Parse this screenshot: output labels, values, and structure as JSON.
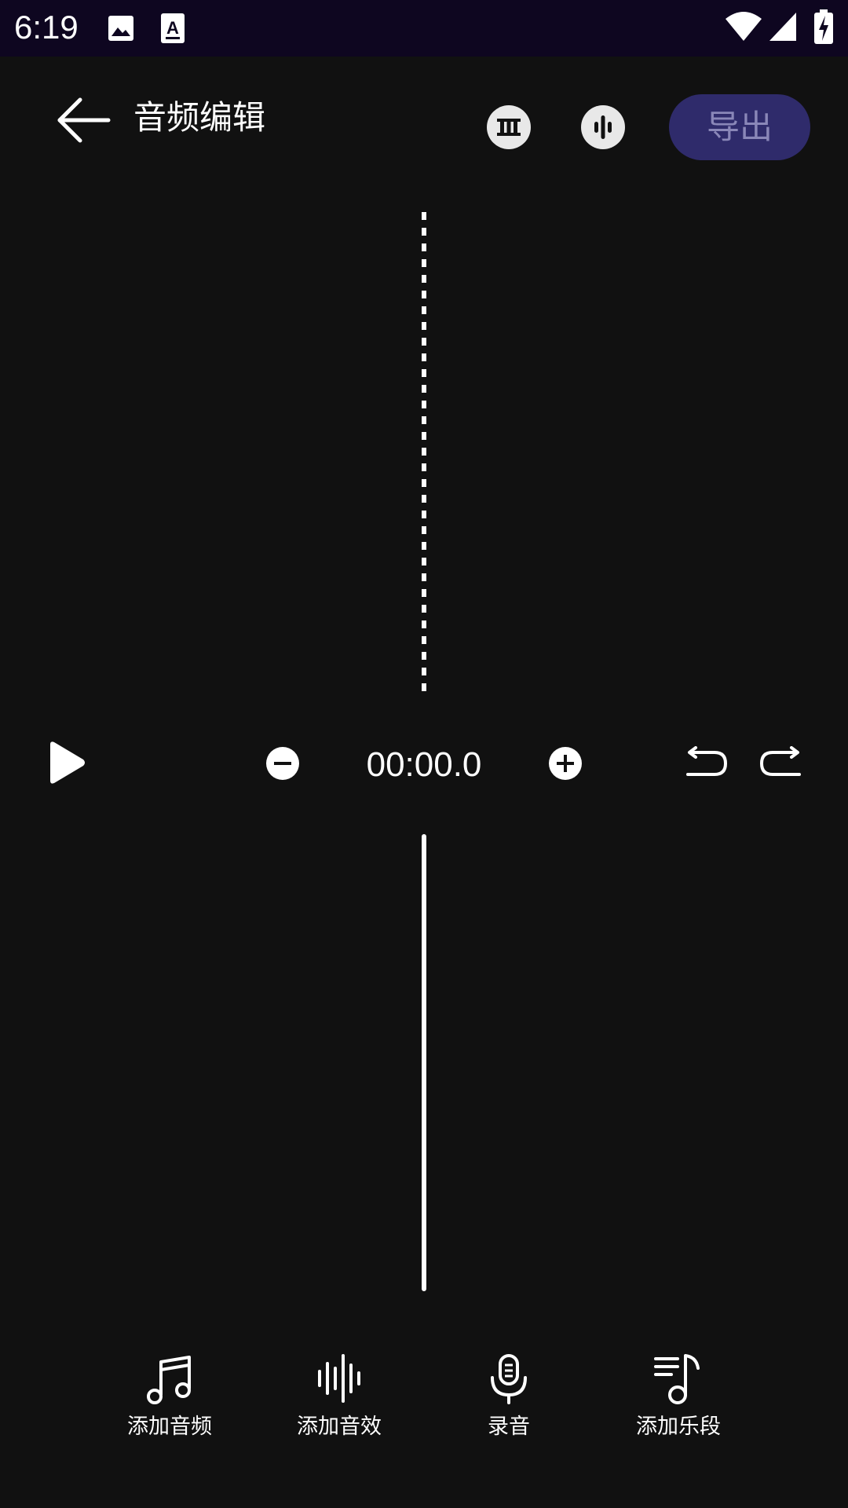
{
  "status_bar": {
    "time": "6:19",
    "icons": [
      "image-icon",
      "text-icon",
      "wifi-icon",
      "signal-icon",
      "battery-charging-icon"
    ]
  },
  "header": {
    "back_icon": "arrow-left-icon",
    "title": "音频编辑",
    "tool_icons": [
      "film-strip-icon",
      "waveform-icon"
    ],
    "export_label": "导出"
  },
  "transport": {
    "play_icon": "play-icon",
    "zoom_out_icon": "minus-circle-icon",
    "time": "00:00.0",
    "zoom_in_icon": "plus-circle-icon",
    "undo_icon": "undo-icon",
    "redo_icon": "redo-icon"
  },
  "toolbar": {
    "items": [
      {
        "label": "添加音频",
        "icon": "music-note-icon"
      },
      {
        "label": "添加音效",
        "icon": "sound-wave-icon"
      },
      {
        "label": "录音",
        "icon": "microphone-icon"
      },
      {
        "label": "添加乐段",
        "icon": "music-list-icon"
      }
    ]
  },
  "colors": {
    "background": "#111111",
    "status_bar": "#0e0620",
    "export_button": "#2f2b6b",
    "export_text": "#8a87b8"
  }
}
